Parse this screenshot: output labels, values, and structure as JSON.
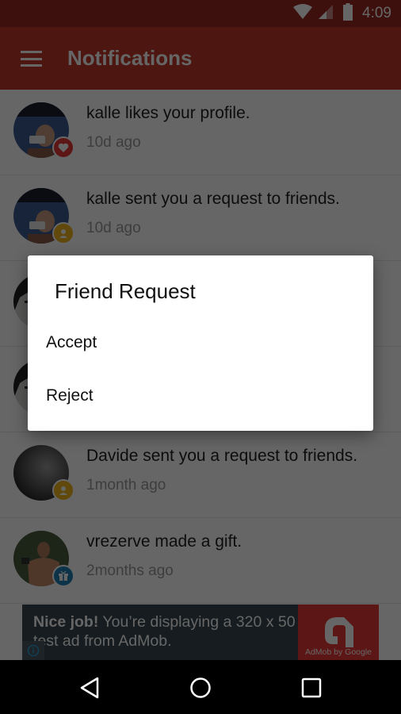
{
  "status_bar": {
    "time": "4:09",
    "icons": [
      "wifi-icon",
      "cell-signal-icon",
      "battery-icon"
    ]
  },
  "app_bar": {
    "menu_icon": "hamburger-menu-icon",
    "title": "Notifications"
  },
  "notifications": [
    {
      "text": "kalle likes your profile.",
      "time": "10d ago",
      "badge": "heart-icon",
      "badge_color": "#e53935",
      "avatar": "selfie-photo"
    },
    {
      "text": "kalle sent you a request to friends.",
      "time": "10d ago",
      "badge": "person-icon",
      "badge_color": "#f2b31d",
      "avatar": "selfie-photo"
    },
    {
      "text": "",
      "time": "",
      "badge": "",
      "badge_color": "",
      "avatar": "face-photo"
    },
    {
      "text": "",
      "time": "",
      "badge": "",
      "badge_color": "",
      "avatar": "face-photo"
    },
    {
      "text": "Davide sent you a request to friends.",
      "time": "1month ago",
      "badge": "person-icon",
      "badge_color": "#f2b31d",
      "avatar": "dark-photo"
    },
    {
      "text": "vrezerve made a gift.",
      "time": "2months ago",
      "badge": "gift-icon",
      "badge_color": "#1e7fb5",
      "avatar": "bodybuilder-photo"
    }
  ],
  "ad": {
    "headline": "Nice job!",
    "body": " You’re displaying a 320 x 50 test ad from AdMob.",
    "logo_caption": "AdMob by Google",
    "info_icon": "info-icon"
  },
  "dialog": {
    "title": "Friend Request",
    "options": [
      "Accept",
      "Reject"
    ]
  },
  "nav_bar": {
    "buttons": [
      "back-icon",
      "home-icon",
      "recents-icon"
    ]
  },
  "colors": {
    "primary": "#c0392b",
    "primary_dark": "#9c2a22",
    "scrim": "rgba(0,0,0,0.6)"
  }
}
